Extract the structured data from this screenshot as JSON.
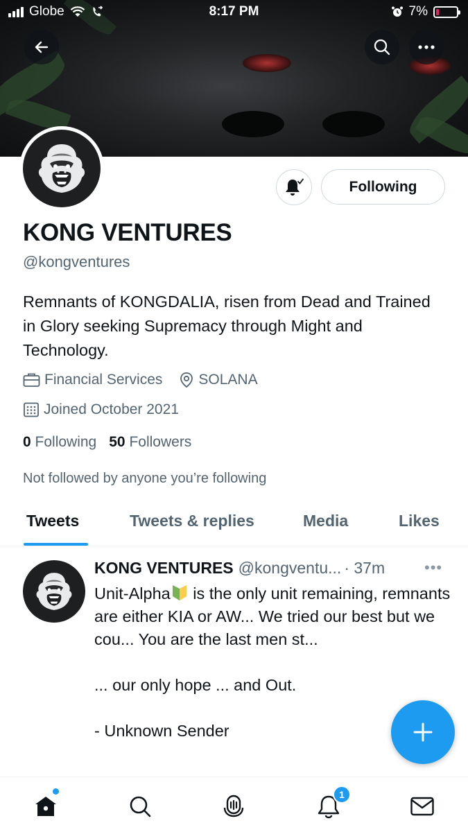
{
  "status_bar": {
    "carrier": "Globe",
    "time": "8:17 PM",
    "battery": "7%",
    "battery_level": 0.07
  },
  "profile": {
    "name": "KONG VENTURES",
    "handle": "@kongventures",
    "bio": "Remnants of KONGDALIA, risen from Dead and Trained in Glory seeking Supremacy through Might and Technology.",
    "category": "Financial Services",
    "location": "SOLANA",
    "joined": "Joined October 2021",
    "following_count": "0",
    "following_label": "Following",
    "followers_count": "50",
    "followers_label": "Followers",
    "not_followed_text": "Not followed by anyone you’re following",
    "follow_button_label": "Following"
  },
  "tabs": [
    {
      "label": "Tweets",
      "active": true
    },
    {
      "label": "Tweets & replies",
      "active": false
    },
    {
      "label": "Media",
      "active": false
    },
    {
      "label": "Likes",
      "active": false
    }
  ],
  "tweet": {
    "author_name": "KONG VENTURES",
    "author_handle": "@kongventu...",
    "time": "· 37m",
    "more": "•••",
    "text_before_emoji": "Unit-Alpha",
    "text_after_emoji": " is the only unit remaining, remnants are either KIA or AW... We tried our best but we cou... You are the last men st...\n\n... our only hope ... and Out.\n\n- Unknown Sender"
  },
  "bottom_nav": {
    "notification_badge": "1"
  },
  "colors": {
    "accent": "#1d9bf0",
    "text_primary": "#0f1419",
    "text_secondary": "#536471",
    "border": "#cfd9de"
  },
  "icons": {
    "back": "arrow-left-icon",
    "search": "search-icon",
    "more": "more-horizontal-icon",
    "bell": "bell-subscribed-icon",
    "category": "briefcase-icon",
    "location": "location-pin-icon",
    "joined": "calendar-icon",
    "home": "home-icon",
    "explore": "search-icon",
    "spaces": "microphone-icon",
    "notifications": "bell-icon",
    "messages": "envelope-icon",
    "compose": "plus-icon"
  }
}
